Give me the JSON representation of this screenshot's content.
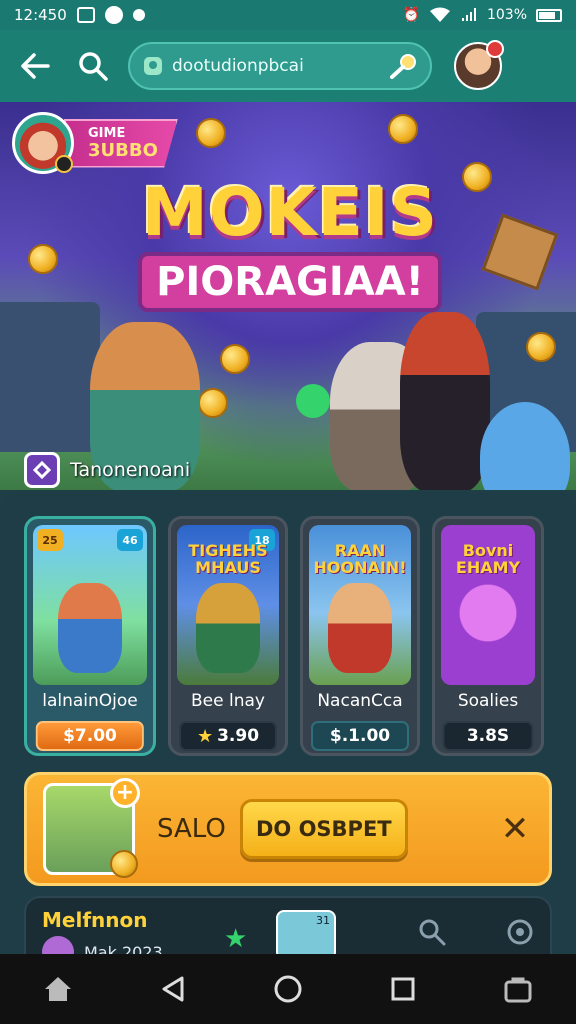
{
  "status_bar": {
    "time": "12:450",
    "battery": "103%"
  },
  "top_bar": {
    "search_text": "dootudionpbcai"
  },
  "banner": {
    "profile_line1": "GIME",
    "profile_line2": "3UBBO",
    "title_line1": "MOKEIS",
    "title_line2": "PIORAGIAA!",
    "caption": "Tanonenoani"
  },
  "cards": [
    {
      "title": "",
      "badge_left": "25",
      "badge_right": "46",
      "name": "lalnainOjoe",
      "price": "$7.00",
      "price_style": "orange",
      "accent": "#3ab0a0"
    },
    {
      "title": "TIGHEHS MHAUS",
      "badge_left": "",
      "badge_right": "18",
      "name": "Bee lnay",
      "price": "3.90",
      "price_style": "dark",
      "show_star": true
    },
    {
      "title": "RAAN HOONAIN!",
      "badge_left": "",
      "badge_right": "",
      "name": "NacanCca",
      "price": "$.1.00",
      "price_style": "teal"
    },
    {
      "title": "Bovni EHAMY",
      "badge_left": "",
      "badge_right": "",
      "name": "Soalies",
      "price": "3.8S",
      "price_style": "dark"
    }
  ],
  "promo": {
    "label": "SALO",
    "cta": "DO OSBPET",
    "close": "✕"
  },
  "list_preview": {
    "title": "Melfnnon",
    "subtitle": "Mak 2023",
    "thumb_badge": "31"
  },
  "colors": {
    "teal_bar": "#1b7f74",
    "accent_gold": "#ffd23a",
    "promo_orange": "#f6a623",
    "panel_bg": "#1e3d47"
  },
  "icons": [
    "back-arrow-icon",
    "search-icon",
    "map-pin-icon",
    "search-key-icon",
    "home-icon",
    "back-nav-icon",
    "circle-home-icon",
    "recents-icon",
    "bag-icon"
  ]
}
